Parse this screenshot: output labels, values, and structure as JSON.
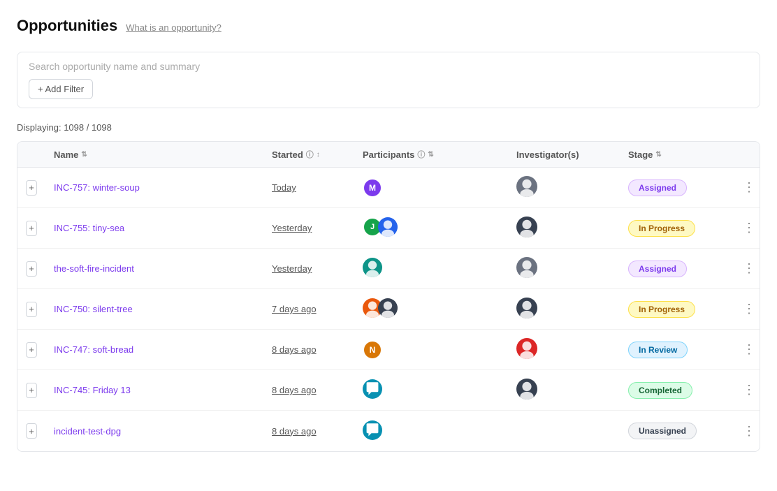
{
  "header": {
    "title": "Opportunities",
    "subtitle": "What is an opportunity?"
  },
  "search": {
    "placeholder": "Search opportunity name and summary"
  },
  "add_filter_label": "+ Add Filter",
  "display_count": "Displaying: 1098 / 1098",
  "table": {
    "columns": [
      {
        "id": "expand",
        "label": ""
      },
      {
        "id": "name",
        "label": "Name",
        "sortable": true
      },
      {
        "id": "started",
        "label": "Started",
        "sortable": true,
        "info": true
      },
      {
        "id": "participants",
        "label": "Participants",
        "info": true,
        "sortable": true
      },
      {
        "id": "investigators",
        "label": "Investigator(s)"
      },
      {
        "id": "stage",
        "label": "Stage",
        "sortable": true
      },
      {
        "id": "actions",
        "label": ""
      }
    ],
    "rows": [
      {
        "id": "row-1",
        "name": "INC-757: winter-soup",
        "started": "Today",
        "participants": [
          {
            "initials": "M",
            "color": "av-purple"
          }
        ],
        "investigators": [
          {
            "initials": "🖼",
            "color": "av-gray",
            "type": "img"
          }
        ],
        "stage": "Assigned",
        "stage_class": "badge-assigned"
      },
      {
        "id": "row-2",
        "name": "INC-755: tiny-sea",
        "started": "Yesterday",
        "participants": [
          {
            "initials": "J",
            "color": "av-green"
          },
          {
            "initials": "👤",
            "color": "av-blue",
            "type": "img"
          }
        ],
        "investigators": [
          {
            "initials": "🖼",
            "color": "av-dark",
            "type": "img"
          }
        ],
        "stage": "In Progress",
        "stage_class": "badge-inprogress"
      },
      {
        "id": "row-3",
        "name": "the-soft-fire-incident",
        "started": "Yesterday",
        "participants": [
          {
            "initials": "🖼",
            "color": "av-teal",
            "type": "img"
          }
        ],
        "investigators": [
          {
            "initials": "🖼",
            "color": "av-gray",
            "type": "img"
          }
        ],
        "stage": "Assigned",
        "stage_class": "badge-assigned"
      },
      {
        "id": "row-4",
        "name": "INC-750: silent-tree",
        "started": "7 days ago",
        "participants": [
          {
            "initials": "🖼",
            "color": "av-orange",
            "type": "img"
          },
          {
            "initials": "🖼",
            "color": "av-dark",
            "type": "img"
          }
        ],
        "investigators": [
          {
            "initials": "🖼",
            "color": "av-dark",
            "type": "img"
          }
        ],
        "stage": "In Progress",
        "stage_class": "badge-inprogress"
      },
      {
        "id": "row-5",
        "name": "INC-747: soft-bread",
        "started": "8 days ago",
        "participants": [
          {
            "initials": "N",
            "color": "av-amber"
          }
        ],
        "investigators": [
          {
            "initials": "🖼",
            "color": "av-red",
            "type": "img"
          }
        ],
        "stage": "In Review",
        "stage_class": "badge-inreview"
      },
      {
        "id": "row-6",
        "name": "INC-745: Friday 13",
        "started": "8 days ago",
        "participants": [
          {
            "initials": "👤",
            "color": "av-cyan",
            "type": "img"
          }
        ],
        "investigators": [
          {
            "initials": "🖼",
            "color": "av-dark",
            "type": "img"
          }
        ],
        "stage": "Completed",
        "stage_class": "badge-completed"
      },
      {
        "id": "row-7",
        "name": "incident-test-dpg",
        "started": "8 days ago",
        "participants": [
          {
            "initials": "👤",
            "color": "av-cyan",
            "type": "img"
          }
        ],
        "investigators": [],
        "stage": "Unassigned",
        "stage_class": "badge-unassigned"
      }
    ]
  }
}
